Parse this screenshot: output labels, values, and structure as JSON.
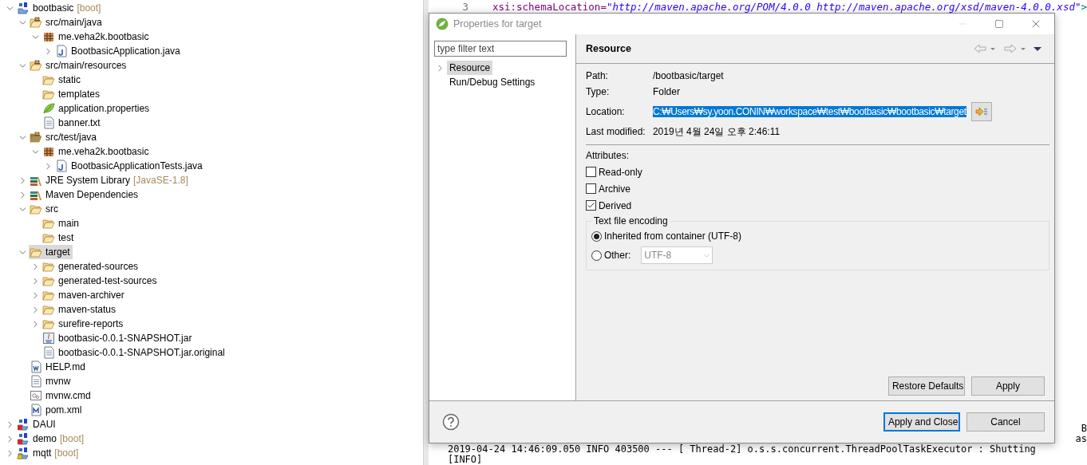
{
  "project_explorer": {
    "items": [
      {
        "label": "bootbasic",
        "suffix": "[boot]",
        "kind": "project",
        "expanded": true,
        "selected": false,
        "children": [
          {
            "label": "src/main/java",
            "kind": "srcfolder",
            "expanded": true,
            "selected": false,
            "children": [
              {
                "label": "me.veha2k.bootbasic",
                "kind": "package",
                "expanded": true,
                "selected": false,
                "children": [
                  {
                    "label": "BootbasicApplication.java",
                    "kind": "java",
                    "expanded": false,
                    "selected": false
                  }
                ]
              }
            ]
          },
          {
            "label": "src/main/resources",
            "kind": "srcfolder",
            "expanded": true,
            "selected": false,
            "children": [
              {
                "label": "static",
                "kind": "folder",
                "selected": false
              },
              {
                "label": "templates",
                "kind": "folder",
                "selected": false
              },
              {
                "label": "application.properties",
                "kind": "leaf",
                "selected": false
              },
              {
                "label": "banner.txt",
                "kind": "text",
                "selected": false
              }
            ]
          },
          {
            "label": "src/test/java",
            "kind": "testfolder",
            "expanded": true,
            "selected": false,
            "children": [
              {
                "label": "me.veha2k.bootbasic",
                "kind": "package",
                "expanded": true,
                "selected": false,
                "children": [
                  {
                    "label": "BootbasicApplicationTests.java",
                    "kind": "java",
                    "expanded": false,
                    "selected": false
                  }
                ]
              }
            ]
          },
          {
            "label": "JRE System Library",
            "suffix": "[JavaSE-1.8]",
            "kind": "library",
            "expanded": false,
            "selected": false
          },
          {
            "label": "Maven Dependencies",
            "kind": "library",
            "expanded": false,
            "selected": false
          },
          {
            "label": "src",
            "kind": "folder",
            "expanded": true,
            "selected": false,
            "children": [
              {
                "label": "main",
                "kind": "folder",
                "selected": false
              },
              {
                "label": "test",
                "kind": "folder",
                "selected": false
              }
            ]
          },
          {
            "label": "target",
            "kind": "folder",
            "expanded": true,
            "selected": true,
            "children": [
              {
                "label": "generated-sources",
                "kind": "folder",
                "expanded": false,
                "selected": false
              },
              {
                "label": "generated-test-sources",
                "kind": "folder",
                "expanded": false,
                "selected": false
              },
              {
                "label": "maven-archiver",
                "kind": "folder",
                "expanded": false,
                "selected": false
              },
              {
                "label": "maven-status",
                "kind": "folder",
                "expanded": false,
                "selected": false
              },
              {
                "label": "surefire-reports",
                "kind": "folder",
                "expanded": false,
                "selected": false
              },
              {
                "label": "bootbasic-0.0.1-SNAPSHOT.jar",
                "kind": "jar",
                "selected": false
              },
              {
                "label": "bootbasic-0.0.1-SNAPSHOT.jar.original",
                "kind": "text",
                "selected": false
              }
            ]
          },
          {
            "label": "HELP.md",
            "kind": "word",
            "selected": false
          },
          {
            "label": "mvnw",
            "kind": "text",
            "selected": false
          },
          {
            "label": "mvnw.cmd",
            "kind": "cmd",
            "selected": false
          },
          {
            "label": "pom.xml",
            "kind": "maven",
            "selected": false
          }
        ]
      },
      {
        "label": "DAUI",
        "kind": "project_error",
        "expanded": false,
        "selected": false
      },
      {
        "label": "demo",
        "suffix": "[boot]",
        "kind": "project_error",
        "expanded": false,
        "selected": false
      },
      {
        "label": "mqtt",
        "suffix": "[boot]",
        "kind": "project_warning",
        "expanded": false,
        "selected": false
      }
    ]
  },
  "editor": {
    "line_number": "3",
    "attribute": "xsi:schemaLocation=",
    "value": "\"http://maven.apache.org/POM/4.0.0 http://maven.apache.org/xsd/maven-4.0.0.xsd\"",
    "tail": ">"
  },
  "console": {
    "lines": [
      {
        "kind": "fragment",
        "text": "B"
      },
      {
        "kind": "fragment",
        "text": "as"
      },
      {
        "kind": "line",
        "text": "2019-04-24 14:46:09.050  INFO 403500 --- [       Thread-2] o.s.s.concurrent.ThreadPoolTaskExecutor  : Shutting"
      },
      {
        "kind": "line",
        "text": "[INFO]"
      }
    ]
  },
  "dialog": {
    "title": "Properties for target",
    "filter": {
      "placeholder": "type filter text"
    },
    "nav": [
      {
        "label": "Resource",
        "selected": true,
        "expanded": false
      },
      {
        "label": "Run/Debug Settings",
        "selected": false
      }
    ],
    "page": {
      "title": "Resource",
      "fields": [
        {
          "label": "Path:",
          "value": "/bootbasic/target",
          "selected": false
        },
        {
          "label": "Type:",
          "value": "Folder",
          "selected": false
        },
        {
          "label": "Location:",
          "value": "C:₩Users₩sy.yoon.CONIN₩workspace₩test₩bootbasic₩bootbasic₩target",
          "selected": true,
          "kind": "location"
        },
        {
          "label": "Last modified:",
          "value": "2019년 4월 24일 오후 2:46:11",
          "selected": false
        }
      ],
      "attributes_label": "Attributes:",
      "checkboxes": [
        {
          "label": "Read-only",
          "checked": false
        },
        {
          "label": "Archive",
          "checked": false
        },
        {
          "label": "Derived",
          "checked": true
        }
      ],
      "encoding": {
        "title": "Text file encoding",
        "options": [
          {
            "label": "Inherited from container (UTF-8)",
            "selected": true
          },
          {
            "label": "Other:",
            "selected": false
          }
        ],
        "select": {
          "value": "UTF-8",
          "disabled": true
        }
      },
      "buttons": [
        {
          "label": "Restore Defaults"
        },
        {
          "label": "Apply"
        }
      ]
    },
    "footer_buttons": [
      {
        "label": "Apply and Close",
        "default": true
      },
      {
        "label": "Cancel",
        "default": false
      }
    ]
  }
}
